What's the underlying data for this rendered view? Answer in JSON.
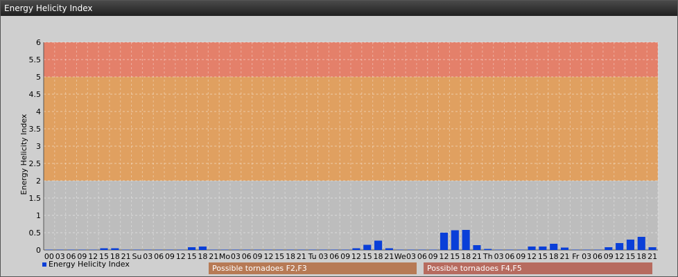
{
  "window": {
    "title": "Energy Helicity Index"
  },
  "chart_data": {
    "type": "bar",
    "title": "Energy Helicity Index",
    "ylabel": "Energy Helicity Index",
    "xlabel": "",
    "ylim": [
      0,
      6
    ],
    "yticks": [
      "0",
      "0.5",
      "1",
      "1.5",
      "2",
      "2.5",
      "3",
      "3.5",
      "4",
      "4.5",
      "5",
      "5.5",
      "6"
    ],
    "grid": true,
    "legend": "bottom-left",
    "colors": {
      "bar": "#0a3fd8",
      "zone_low": "#bdbdbd",
      "zone_mid": "#e0a060",
      "zone_high": "#e4806a",
      "zone_label_mid": "#b77a55",
      "zone_label_high": "#b76b5f"
    },
    "categories": [
      "00",
      "03",
      "06",
      "09",
      "12",
      "15",
      "18",
      "21",
      "Su",
      "03",
      "06",
      "09",
      "12",
      "15",
      "18",
      "21",
      "Mo",
      "03",
      "06",
      "09",
      "12",
      "15",
      "18",
      "21",
      "Tu",
      "03",
      "06",
      "09",
      "12",
      "15",
      "18",
      "21",
      "We",
      "03",
      "06",
      "09",
      "12",
      "15",
      "18",
      "21",
      "Th",
      "03",
      "06",
      "09",
      "12",
      "15",
      "18",
      "21",
      "Fr",
      "03",
      "06",
      "09",
      "12",
      "15",
      "18",
      "21"
    ],
    "series": [
      {
        "name": "Energy Helicity Index",
        "values": [
          0.01,
          0.01,
          0.01,
          0.01,
          0.01,
          0.05,
          0.05,
          0.01,
          0.01,
          0.01,
          0.01,
          0.01,
          0.01,
          0.08,
          0.1,
          0.01,
          0.01,
          0.01,
          0.01,
          0.01,
          0.01,
          0.01,
          0.01,
          0.01,
          0.01,
          0.01,
          0.01,
          0.01,
          0.05,
          0.15,
          0.27,
          0.05,
          0.01,
          0.01,
          0.01,
          0.01,
          0.5,
          0.57,
          0.58,
          0.14,
          0.03,
          0.01,
          0.01,
          0.01,
          0.1,
          0.1,
          0.18,
          0.07,
          0.01,
          0.01,
          0.01,
          0.08,
          0.2,
          0.3,
          0.38,
          0.08
        ]
      }
    ],
    "zones": [
      {
        "from": 0,
        "to": 2,
        "label": ""
      },
      {
        "from": 2,
        "to": 5,
        "label": "Possible tornadoes F2,F3"
      },
      {
        "from": 5,
        "to": 6,
        "label": "Possible tornadoes F4,F5"
      }
    ]
  }
}
